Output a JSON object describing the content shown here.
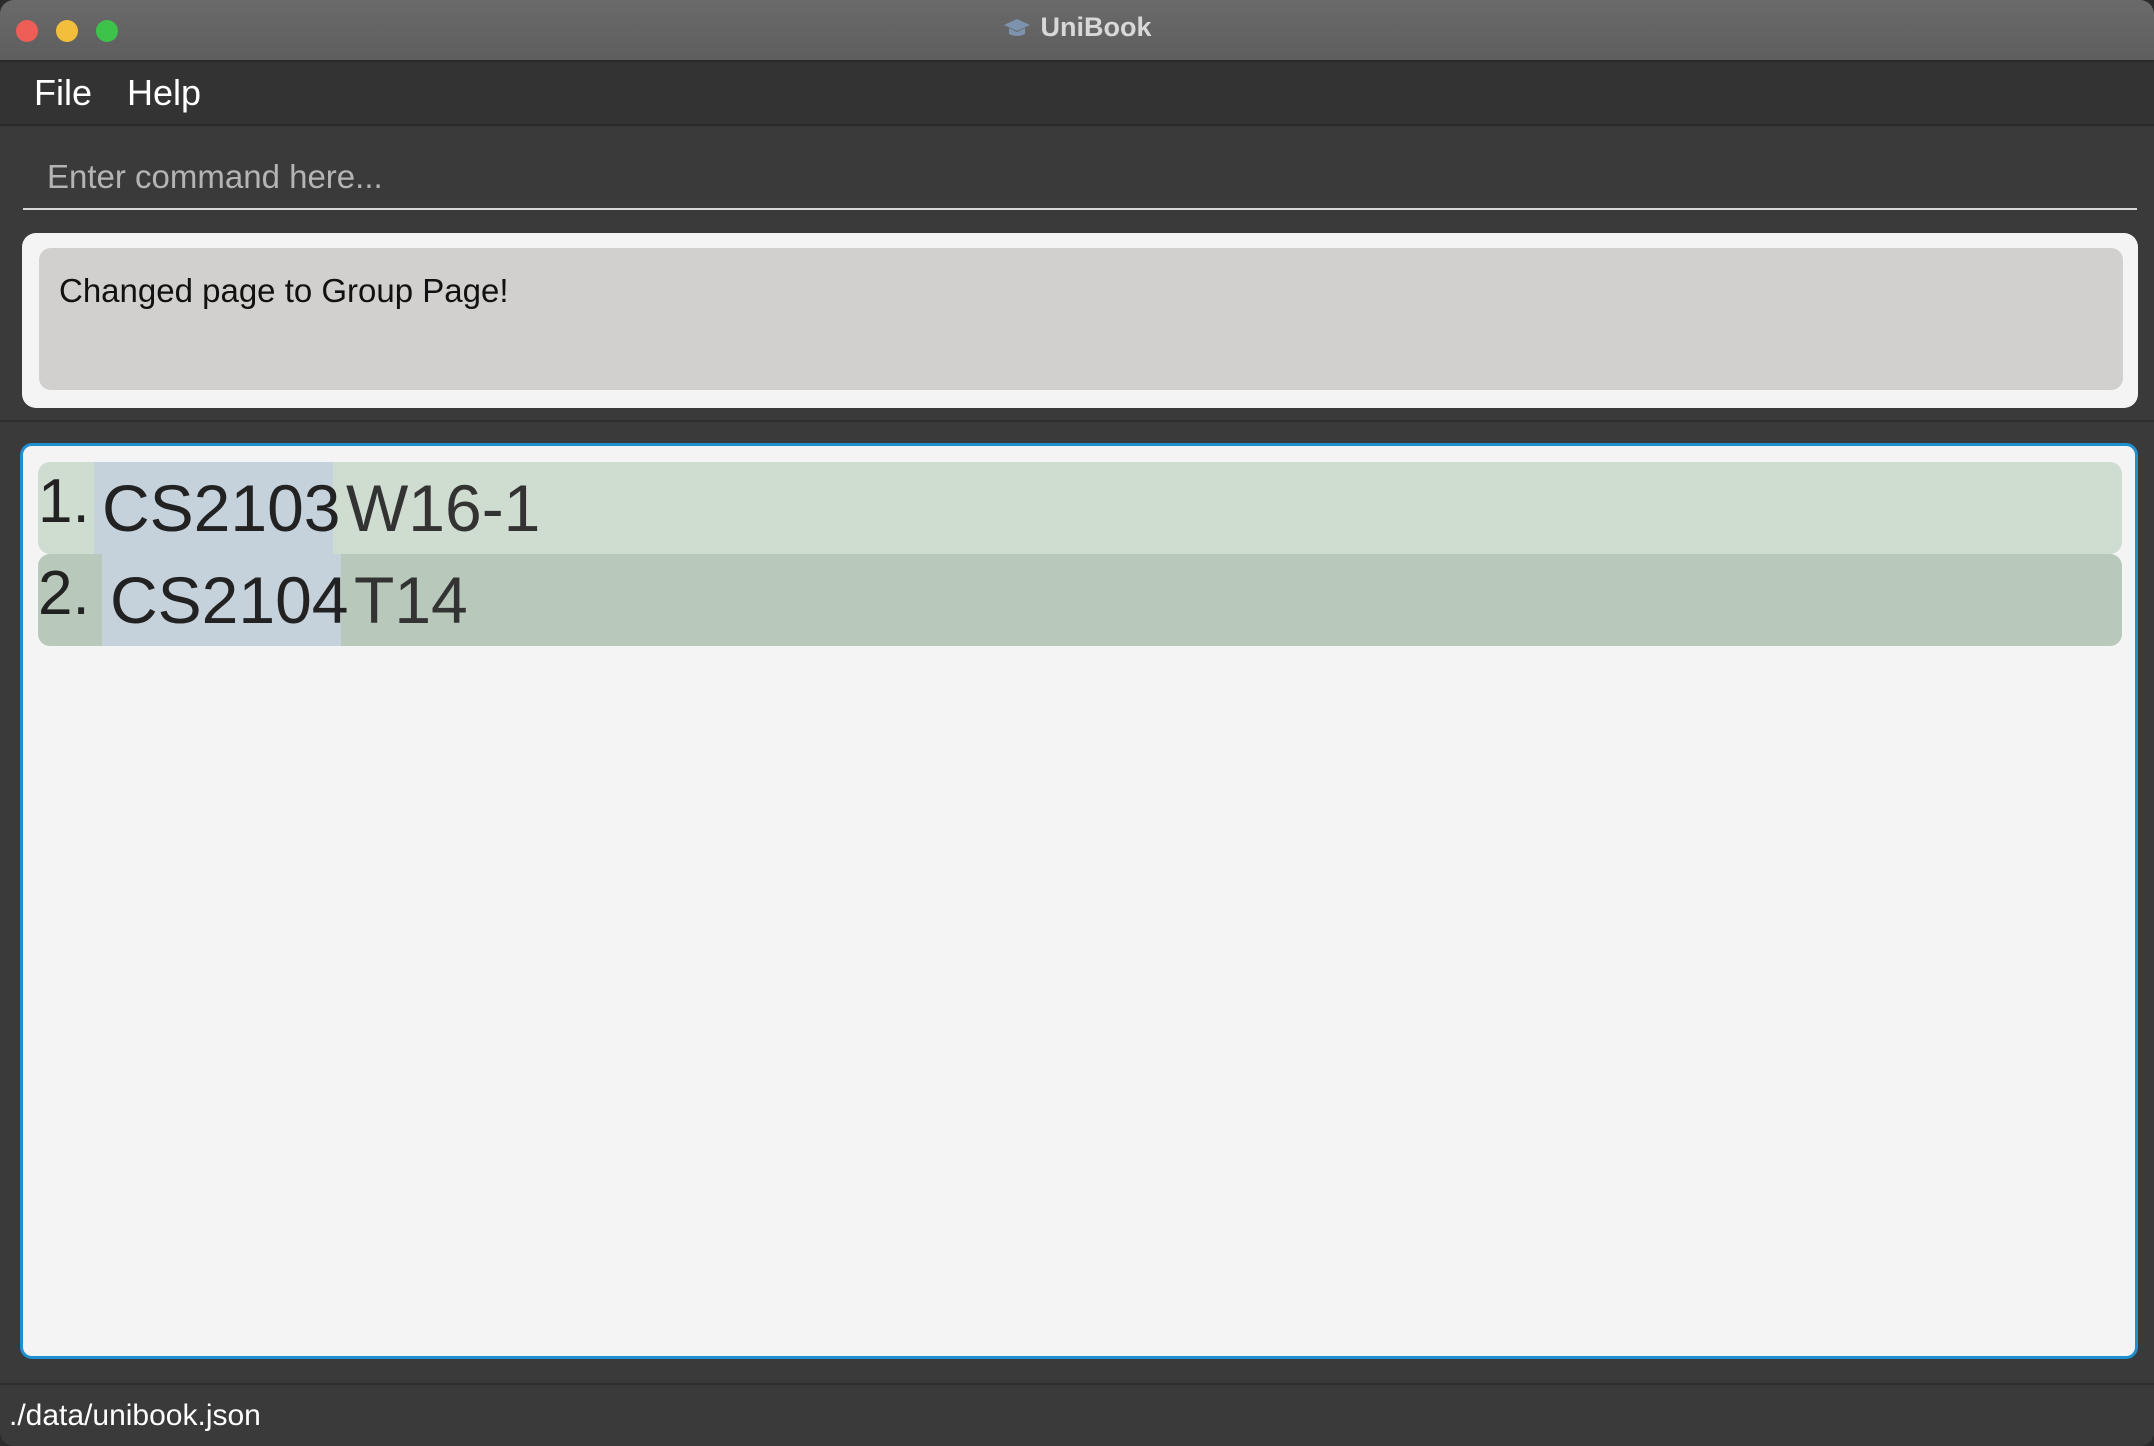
{
  "window": {
    "title": "UniBook",
    "icon": "graduation-cap-icon"
  },
  "menu": {
    "file": "File",
    "help": "Help"
  },
  "command": {
    "placeholder": "Enter command here...",
    "value": ""
  },
  "result": {
    "message": "Changed page to Group Page!"
  },
  "groups": [
    {
      "index": "1.",
      "module": "CS2103",
      "group": "W16-1"
    },
    {
      "index": "2.",
      "module": "CS2104",
      "group": "T14"
    }
  ],
  "status": {
    "path": "./data/unibook.json"
  },
  "colors": {
    "accent_border": "#1e8fcf",
    "row_odd": "#cfddd0",
    "row_even": "#b8c8ba",
    "module_tag": "#c5d2dc"
  }
}
